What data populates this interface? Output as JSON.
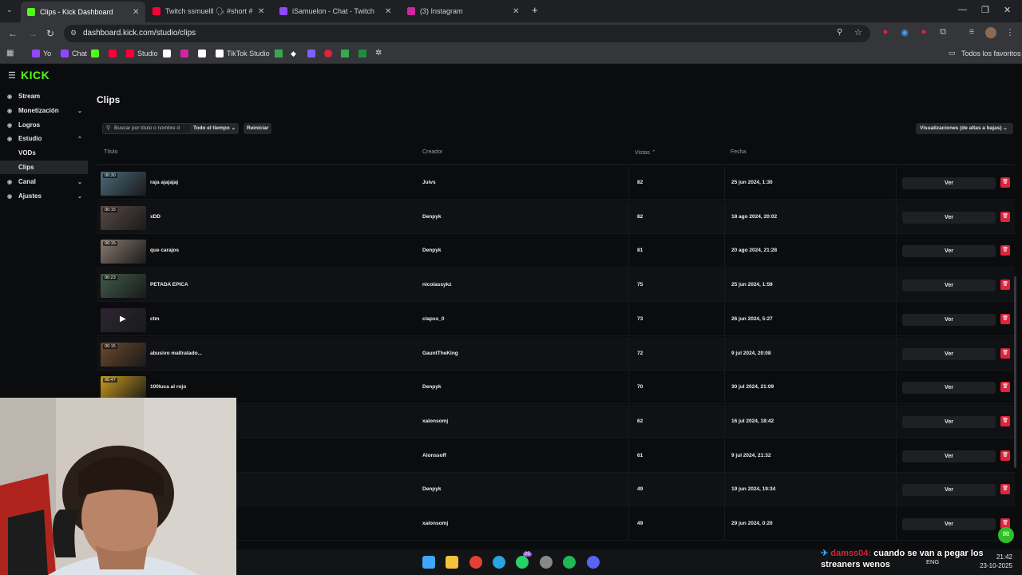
{
  "browser": {
    "tabs": [
      {
        "label": "Clips - Kick Dashboard",
        "color": "#53fc18",
        "active": true
      },
      {
        "label": "Twitch ssmuelll 🗣 #short #hu",
        "color": "#ff0033",
        "active": false
      },
      {
        "label": "iSamuelon - Chat - Twitch",
        "color": "#9146ff",
        "active": false
      },
      {
        "label": "(3) Instagram",
        "color": "#d6249f",
        "active": false
      }
    ],
    "url": "dashboard.kick.com/studio/clips",
    "bookmarks": [
      {
        "label": "Yo",
        "color": "#9146ff"
      },
      {
        "label": "Chat",
        "color": "#9146ff"
      },
      {
        "label": "",
        "color": "#53fc18"
      },
      {
        "label": "",
        "color": "#ff0033"
      },
      {
        "label": "Studio",
        "color": "#ff0033"
      },
      {
        "label": "",
        "color": "#ffffff"
      },
      {
        "label": "",
        "color": "#d6249f"
      },
      {
        "label": "",
        "color": "#ffffff"
      },
      {
        "label": "TikTok Studio",
        "color": "#ffffff"
      }
    ],
    "all_bookmarks": "Todos los favoritos"
  },
  "sidebar": {
    "brand": "KICK",
    "items": [
      {
        "label": "Stream",
        "icon": "broadcast-icon",
        "chev": ""
      },
      {
        "label": "Monetización",
        "icon": "dollar-icon",
        "chev": "⌄"
      },
      {
        "label": "Logros",
        "icon": "trophy-icon",
        "chev": ""
      },
      {
        "label": "Estudio",
        "icon": "film-icon",
        "chev": "⌃"
      },
      {
        "label": "VODs",
        "icon": "",
        "chev": ""
      },
      {
        "label": "Clips",
        "icon": "",
        "chev": ""
      },
      {
        "label": "Canal",
        "icon": "tv-icon",
        "chev": "⌄"
      },
      {
        "label": "Ajustes",
        "icon": "gear-icon",
        "chev": "⌄"
      }
    ]
  },
  "page": {
    "title": "Clips",
    "search_placeholder": "Buscar por título o nombre d",
    "time_filter": "Todo el tiempo",
    "reset": "Reiniciar",
    "sort": "Visualizaciones (de altas a bajas)",
    "columns": {
      "title": "Título",
      "creator": "Creador",
      "views": "Vistas ⌃",
      "date": "Fecha"
    },
    "view_label": "Ver",
    "rows": [
      {
        "duration": "00:30",
        "title": "raja ajajajaj",
        "creator": "Juivs",
        "views": "82",
        "date": "25 jun 2024, 1:30",
        "thumb": "#4a6a7a"
      },
      {
        "duration": "00:15",
        "title": "xDD",
        "creator": "Denpyk",
        "views": "82",
        "date": "18 ago 2024, 20:02",
        "thumb": "#5a4a44"
      },
      {
        "duration": "00:15",
        "title": "que carajos",
        "creator": "Denpyk",
        "views": "81",
        "date": "20 ago 2024, 21:28",
        "thumb": "#8a7a70"
      },
      {
        "duration": "00:23",
        "title": "PETADA EPICA",
        "creator": "nicolassykz",
        "views": "75",
        "date": "25 jun 2024, 1:59",
        "thumb": "#3f5c4a"
      },
      {
        "duration": "",
        "title": "ctm",
        "creator": "clapss_0",
        "views": "73",
        "date": "26 jun 2024, 5:27",
        "thumb": "#2d2533"
      },
      {
        "duration": "00:15",
        "title": "abusivo maltratado...",
        "creator": "GauntTheKing",
        "views": "72",
        "date": "9 jul 2024, 20:08",
        "thumb": "#6b4a2a"
      },
      {
        "duration": "00:47",
        "title": "100luca al rojo",
        "creator": "Denpyk",
        "views": "70",
        "date": "30 jul 2024, 21:09",
        "thumb": "#c99a1a"
      },
      {
        "duration": "",
        "title": "",
        "creator": "xalonsomj",
        "views": "62",
        "date": "16 jul 2024, 18:42",
        "thumb": ""
      },
      {
        "duration": "",
        "title": "",
        "creator": "Alonssoff",
        "views": "61",
        "date": "9 jul 2024, 21:32",
        "thumb": ""
      },
      {
        "duration": "",
        "title": "",
        "creator": "Denpyk",
        "views": "49",
        "date": "19 jun 2024, 19:34",
        "thumb": ""
      },
      {
        "duration": "",
        "title": "",
        "creator": "xalonsomj",
        "views": "49",
        "date": "29 jun 2024, 0:20",
        "thumb": ""
      }
    ]
  },
  "overlay": {
    "chat_user": "damss04:",
    "chat_text": "cuando se van a pegar los streaners wenos"
  },
  "taskbar": {
    "lang": "ENG",
    "time": "21:42",
    "date": "23-10-2025",
    "whatsapp_badge": "25"
  }
}
